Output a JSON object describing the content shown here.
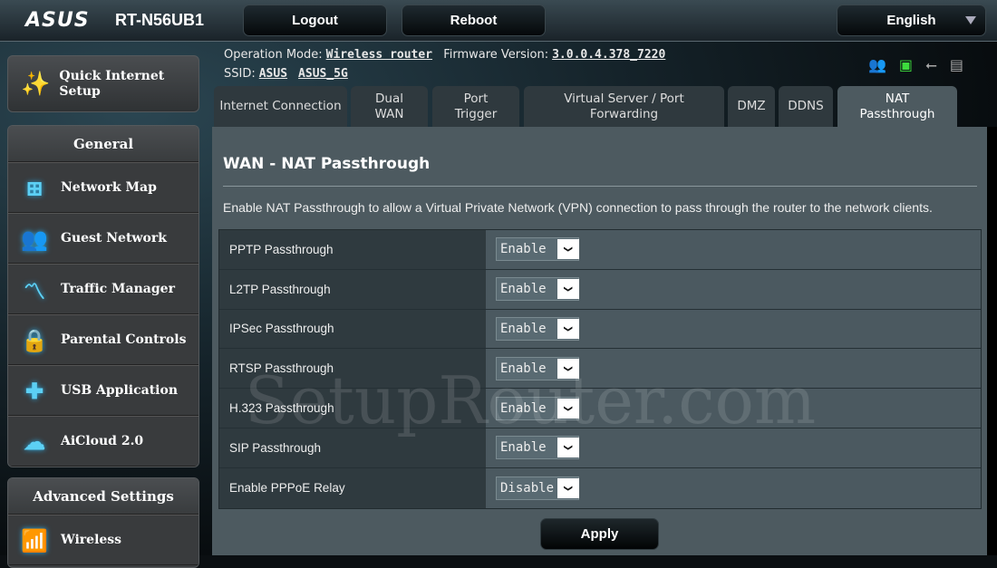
{
  "header": {
    "logo": "ASUS",
    "model": "RT-N56UB1",
    "logout": "Logout",
    "reboot": "Reboot",
    "language": "English"
  },
  "info": {
    "op_mode_label": "Operation Mode:",
    "op_mode": "Wireless router",
    "fw_label": "Firmware Version:",
    "fw": "3.0.0.4.378_7220",
    "ssid_label": "SSID:",
    "ssid1": "ASUS",
    "ssid2": "ASUS_5G"
  },
  "status_icons": [
    "clients-icon",
    "network-status-icon",
    "usb-icon",
    "printer-icon"
  ],
  "sidebar": {
    "quick_setup": "Quick Internet Setup",
    "general": "General",
    "items": [
      {
        "label": "Network Map",
        "icon": "network-map-icon"
      },
      {
        "label": "Guest Network",
        "icon": "guest-network-icon"
      },
      {
        "label": "Traffic Manager",
        "icon": "traffic-manager-icon"
      },
      {
        "label": "Parental Controls",
        "icon": "lock-icon"
      },
      {
        "label": "USB Application",
        "icon": "puzzle-icon"
      },
      {
        "label": "AiCloud 2.0",
        "icon": "cloud-icon"
      }
    ],
    "advanced": "Advanced Settings",
    "advanced_items": [
      {
        "label": "Wireless",
        "icon": "wifi-icon"
      }
    ]
  },
  "tabs": [
    {
      "label": "Internet Connection"
    },
    {
      "label": "Dual WAN"
    },
    {
      "label": "Port Trigger"
    },
    {
      "label": "Virtual Server / Port Forwarding"
    },
    {
      "label": "DMZ"
    },
    {
      "label": "DDNS"
    },
    {
      "label": "NAT Passthrough",
      "active": true
    }
  ],
  "main": {
    "title": "WAN - NAT Passthrough",
    "description": "Enable NAT Passthrough to allow a Virtual Private Network (VPN) connection to pass through the router to the network clients.",
    "rows": [
      {
        "label": "PPTP Passthrough",
        "value": "Enable"
      },
      {
        "label": "L2TP Passthrough",
        "value": "Enable"
      },
      {
        "label": "IPSec Passthrough",
        "value": "Enable"
      },
      {
        "label": "RTSP Passthrough",
        "value": "Enable"
      },
      {
        "label": "H.323 Passthrough",
        "value": "Enable"
      },
      {
        "label": "SIP Passthrough",
        "value": "Enable"
      },
      {
        "label": "Enable PPPoE Relay",
        "value": "Disable"
      }
    ],
    "apply": "Apply"
  },
  "watermark": "SetupRouter.com",
  "colors": {
    "accent_icon": "#5cd0f5",
    "panel": "#4d5a60",
    "active_status": "#3ddc3d"
  }
}
